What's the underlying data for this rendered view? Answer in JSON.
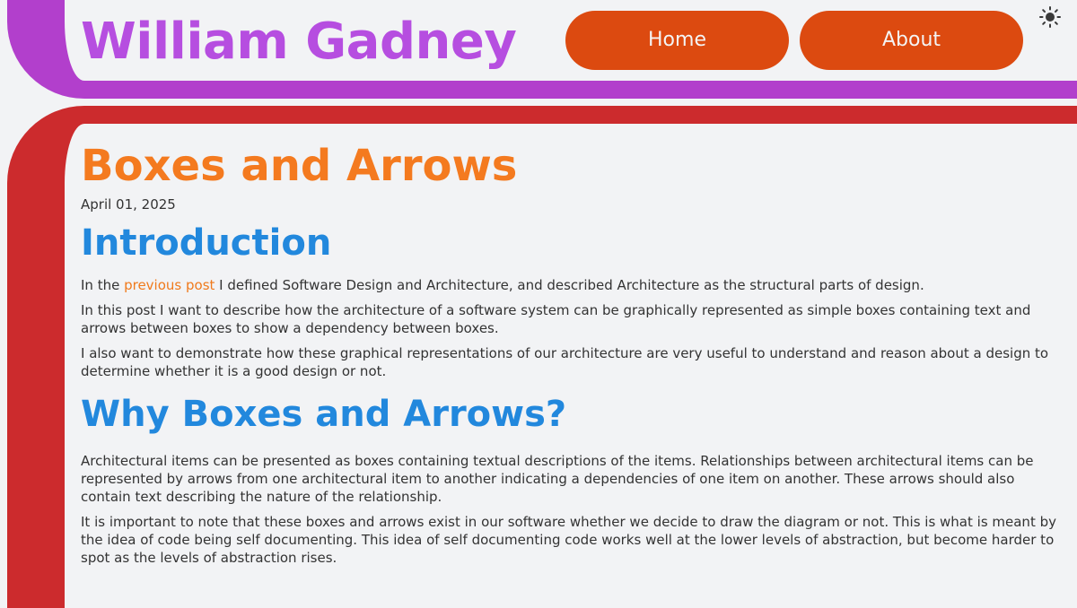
{
  "header": {
    "site_title": "William Gadney",
    "nav": [
      {
        "label": "Home"
      },
      {
        "label": "About"
      }
    ],
    "theme_toggle_icon": "sun-icon"
  },
  "colors": {
    "header_band": "#b23fcc",
    "site_title": "#b64ee0",
    "nav_button": "#dc4a10",
    "content_band": "#cc2b2d",
    "post_title": "#f47a1f",
    "section_heading": "#2288dd",
    "link": "#f07a1c",
    "background": "#f2f3f5",
    "body_text": "#333333"
  },
  "post": {
    "title": "Boxes and Arrows",
    "date": "April 01, 2025",
    "sections": [
      {
        "heading": "Introduction",
        "paragraphs": [
          {
            "before_link": "In the ",
            "link_text": "previous post",
            "after_link": " I defined Software Design and Architecture, and described Architecture as the structural parts of design."
          },
          {
            "text": "In this post I want to describe how the architecture of a software system can be graphically represented as simple boxes containing text and arrows between boxes to show a dependency between boxes."
          },
          {
            "text": "I also want to demonstrate how these graphical representations of our architecture are very useful to understand and reason about a design to determine whether it is a good design or not."
          }
        ]
      },
      {
        "heading": "Why Boxes and Arrows?",
        "paragraphs": [
          {
            "text": "Architectural items can be presented as boxes containing textual descriptions of the items. Relationships between architectural items can be represented by arrows from one architectural item to another indicating a dependencies of one item on another. These arrows should also contain text describing the nature of the relationship."
          },
          {
            "text": "It is important to note that these boxes and arrows exist in our software whether we decide to draw the diagram or not. This is what is meant by the idea of code being self documenting. This idea of self documenting code works well at the lower levels of abstraction, but become harder to spot as the levels of abstraction rises."
          }
        ]
      }
    ]
  }
}
